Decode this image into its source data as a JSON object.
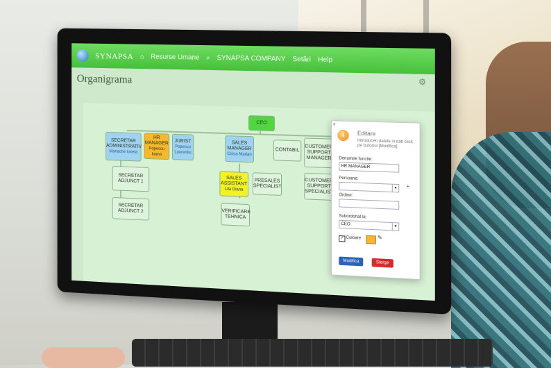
{
  "app": {
    "brand": "SYNAPSA",
    "home_icon": "home-icon",
    "nav": [
      "Resurse Umane"
    ],
    "search_icon": "search-icon",
    "company": "SYNAPSA COMPANY",
    "menus": [
      "Setări",
      "Help"
    ],
    "settings_icon": "gear-icon"
  },
  "page": {
    "title": "Organigrama"
  },
  "org": {
    "ceo": "CEO",
    "ceo_sub": "",
    "nodes": [
      {
        "key": "secretar_admin",
        "label": "SECRETAR ADMINISTRATIV",
        "sub": "Manache Ionela"
      },
      {
        "key": "hr_manager",
        "label": "HR MANAGER",
        "sub": "Popescu Ioana"
      },
      {
        "key": "jurist",
        "label": "JURIST",
        "sub": "Popescu Laurentiu"
      },
      {
        "key": "sales_manager",
        "label": "SALES MANAGER",
        "sub": "Ocica Marian"
      },
      {
        "key": "contabil",
        "label": "CONTABIL",
        "sub": ""
      },
      {
        "key": "customer_support_manager",
        "label": "CUSTOMER SUPPORT MANAGER",
        "sub": ""
      },
      {
        "key": "secretar_adjunct1",
        "label": "SECRETAR ADJUNCT 1",
        "sub": ""
      },
      {
        "key": "secretar_adjunct2",
        "label": "SECRETAR ADJUNCT 2",
        "sub": ""
      },
      {
        "key": "sales_assistant",
        "label": "SALES ASSISTANT",
        "sub": "Lila Diana"
      },
      {
        "key": "presales_specialist",
        "label": "PRESALES SPECIALIST",
        "sub": ""
      },
      {
        "key": "customer_support_specialist",
        "label": "CUSTOMER SUPPORT SPECIALIST",
        "sub": ""
      },
      {
        "key": "verificare_tehnica",
        "label": "VERIFICARE TEHNICA",
        "sub": ""
      }
    ]
  },
  "editor": {
    "title": "Editare",
    "description": "Introduceti datele si dati click pe butonul [Modifica]",
    "denumire_label": "Denumire functie:",
    "denumire_value": "HR MANAGER",
    "persoane_label": "Persoane:",
    "persoane_value": "",
    "ordine_label": "Ordine:",
    "ordine_value": "",
    "subordonat_label": "Subordonat la:",
    "subordonat_value": "CEO",
    "culoare_label": "Culoare",
    "culoare_checked": true,
    "culoare_value": "#f6b631",
    "modifica_label": "Modifica",
    "sterge_label": "Sterge"
  }
}
